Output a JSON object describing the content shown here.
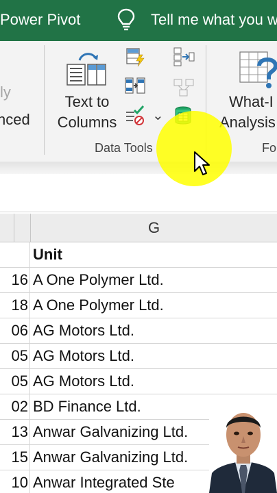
{
  "titlebar": {
    "tab_label": "Power Pivot",
    "tell_me": "Tell me what you w",
    "bulb_icon": "lightbulb-icon",
    "background": "#217346"
  },
  "ribbon": {
    "left_faded_line1": "ly",
    "left_faded_line2": "nced",
    "text_to_columns_line1": "Text to",
    "text_to_columns_line2": "Columns",
    "data_tools_label": "Data Tools",
    "what_if_line1": "What-I",
    "what_if_line2": "Analysis",
    "forecast_partial": "Fo",
    "dropdown_glyph": "⌄"
  },
  "sheet": {
    "column_header": "G",
    "rows": [
      {
        "f": "",
        "g": "Unit",
        "header": true
      },
      {
        "f": "16",
        "g": "A One Polymer Ltd."
      },
      {
        "f": "18",
        "g": "A One Polymer Ltd."
      },
      {
        "f": "06",
        "g": "AG Motors Ltd."
      },
      {
        "f": "05",
        "g": "AG Motors Ltd."
      },
      {
        "f": "05",
        "g": "AG Motors Ltd."
      },
      {
        "f": "02",
        "g": "BD Finance Ltd."
      },
      {
        "f": "13",
        "g": "Anwar Galvanizing Ltd."
      },
      {
        "f": "15",
        "g": "Anwar Galvanizing Ltd."
      },
      {
        "f": "10",
        "g": "Anwar Integrated Ste"
      }
    ]
  },
  "colors": {
    "highlight": "#ffff00",
    "grid_line": "#d4d4d4"
  }
}
